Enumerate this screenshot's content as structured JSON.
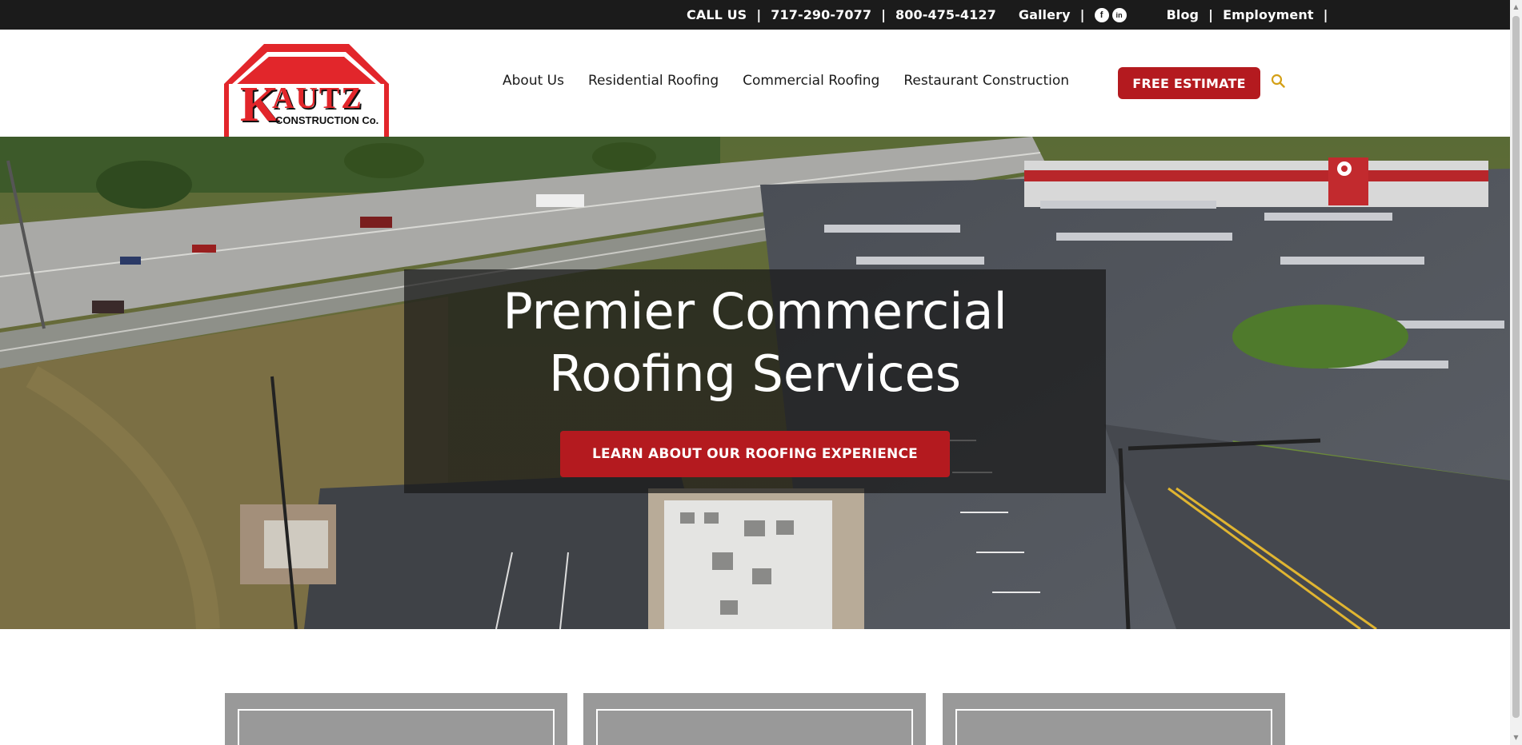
{
  "topbar": {
    "call_label": "CALL US",
    "phone1": "717-290-7077",
    "phone2": "800-475-4127",
    "gallery": "Gallery",
    "facebook_letter": "f",
    "linkedin_letter": "in",
    "blog": "Blog",
    "employment": "Employment",
    "separator": "|"
  },
  "logo": {
    "line1": "KAUTZ",
    "line2": "CONSTRUCTION Co."
  },
  "nav": {
    "items": [
      "About Us",
      "Residential Roofing",
      "Commercial Roofing",
      "Restaurant Construction"
    ],
    "estimate_label": "FREE ESTIMATE"
  },
  "hero": {
    "title_line1": "Premier Commercial",
    "title_line2": "Roofing Services",
    "cta_label": "LEARN ABOUT OUR ROOFING EXPERIENCE"
  },
  "colors": {
    "brand_red": "#b41a1f",
    "topbar_bg": "#1b1b1b",
    "search_icon": "#d4a017"
  }
}
